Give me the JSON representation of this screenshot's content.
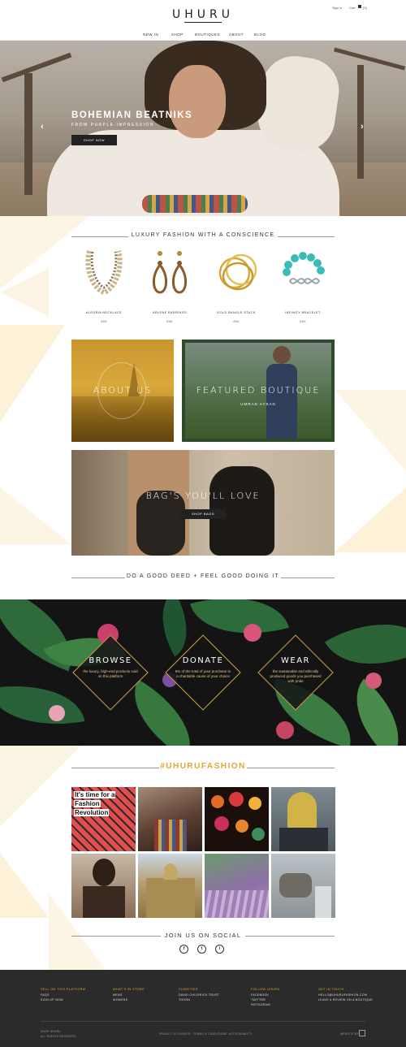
{
  "header": {
    "logo": "UHURU",
    "sign_in": "Sign in",
    "cart": "Cart",
    "cart_count": "(0)",
    "nav": [
      "NEW IN",
      "SHOP",
      "BOUTIQUES",
      "ABOUT",
      "BLOG"
    ]
  },
  "hero": {
    "title": "BOHEMIAN BEATNIKS",
    "subtitle": "FROM PURPLE IMPRESSION",
    "button": "SHOP NOW",
    "prev": "‹",
    "next": "›"
  },
  "products_section": {
    "heading": "LUXURY FASHION WITH A CONSCIENCE",
    "items": [
      {
        "name": "ALEGRIA NECKLACE",
        "price": "£XX"
      },
      {
        "name": "ARLENE EARRINGS",
        "price": "£XX"
      },
      {
        "name": "GOLD BANGLE STACK",
        "price": "£XX"
      },
      {
        "name": "INFINITY BRACELET",
        "price": "£XX"
      }
    ]
  },
  "tiles": {
    "about": "ABOUT US",
    "featured_title": "FEATURED BOUTIQUE",
    "featured_sub": "UMRAN AYSAN",
    "bags_title": "BAG'S YOU'LL LOVE",
    "bags_button": "SHOP BAGS"
  },
  "deed_heading": "DO A GOOD DEED + FEEL GOOD DOING IT",
  "diamonds": [
    {
      "title": "BROWSE",
      "text": "the luxury, high-end products sold on this platform"
    },
    {
      "title": "DONATE",
      "text": "5% of the total of your purchase to a charitable cause of your choice"
    },
    {
      "title": "WEAR",
      "text": "the sustainable and ethically produced goods you purchased with pride"
    }
  ],
  "instagram": {
    "hashtag": "#UHURUFASHION",
    "tile_text": [
      "It's time for a",
      "Fashion",
      "Revolution"
    ]
  },
  "social": {
    "heading": "JOIN US ON SOCIAL",
    "icons": [
      "f",
      "t",
      "i"
    ]
  },
  "footer": {
    "columns": [
      {
        "heading": "SELL ON THIS PLATFORM",
        "items": [
          "FAQS",
          "SIGN UP NOW"
        ]
      },
      {
        "heading": "WHAT'S IN STORE",
        "items": [
          "MENS",
          "WOMENS"
        ]
      },
      {
        "heading": "CHARITIES",
        "items": [
          "DAVID CHILDRICK TRUST",
          "THORN"
        ]
      },
      {
        "heading": "FOLLOW UHURU",
        "items": [
          "FACEBOOK",
          "TWITTER",
          "INSTAGRAM"
        ]
      },
      {
        "heading": "GET IN TOUCH",
        "items": [
          "HELLO@UHURUFASHION.COM",
          "LEAVE A REVIEW ON A BOUTIQUE"
        ]
      }
    ],
    "copyright_1": "SHOP UHURU",
    "copyright_2": "ALL RIGHTS RESERVED",
    "links": [
      "PRIVACY & COOKIES",
      "TERMS & CONDITIONS",
      "ACCESSIBILITY"
    ],
    "credit": "WEBSITE BY"
  }
}
